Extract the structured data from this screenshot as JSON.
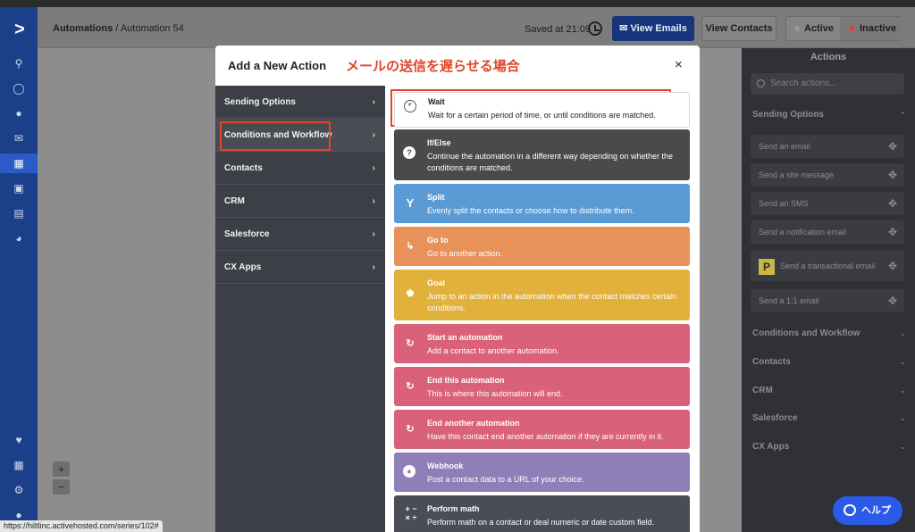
{
  "header": {
    "breadcrumb_root": "Automations",
    "breadcrumb_sep": "/",
    "breadcrumb_current": "Automation 54",
    "saved_text": "Saved at 21:09",
    "view_emails": "View Emails",
    "view_contacts": "View Contacts",
    "status_active": "Active",
    "status_inactive": "Inactive"
  },
  "modal": {
    "title": "Add a New Action",
    "annotation": "メールの送信を遅らせる場合",
    "close": "×",
    "categories": [
      {
        "label": "Sending Options"
      },
      {
        "label": "Conditions and Workflow"
      },
      {
        "label": "Contacts"
      },
      {
        "label": "CRM"
      },
      {
        "label": "Salesforce"
      },
      {
        "label": "CX Apps"
      }
    ],
    "actions": [
      {
        "title": "Wait",
        "desc": "Wait for a certain period of time, or until conditions are matched.",
        "icon": "clock-icon",
        "color": "#ffffff"
      },
      {
        "title": "If/Else",
        "desc": "Continue the automation in a different way depending on whether the conditions are matched.",
        "icon": "question-icon",
        "color": "#4a4a4a"
      },
      {
        "title": "Split",
        "desc": "Evenly split the contacts or choose how to distribute them.",
        "icon": "split-icon",
        "color": "#5b9bd5"
      },
      {
        "title": "Go to",
        "desc": "Go to another action.",
        "icon": "goto-icon",
        "color": "#e8925a"
      },
      {
        "title": "Goal",
        "desc": "Jump to an action in the automation when the contact matches certain conditions.",
        "icon": "trophy-icon",
        "color": "#e2b13c"
      },
      {
        "title": "Start an automation",
        "desc": "Add a contact to another automation.",
        "icon": "refresh-icon",
        "color": "#d9627a"
      },
      {
        "title": "End this automation",
        "desc": "This is where this automation will end.",
        "icon": "refresh-icon",
        "color": "#d9627a"
      },
      {
        "title": "End another automation",
        "desc": "Have this contact end another automation if they are currently in it.",
        "icon": "refresh-icon",
        "color": "#d9627a"
      },
      {
        "title": "Webhook",
        "desc": "Post a contact data to a URL of your choice.",
        "icon": "webhook-icon",
        "color": "#8f7fb8"
      },
      {
        "title": "Perform math",
        "desc": "Perform math on a contact or deal numeric or date custom field.",
        "icon": "math-icon",
        "color": "#4a4d55"
      }
    ]
  },
  "actions_panel": {
    "title": "Actions",
    "search_placeholder": "Search actions...",
    "sections": {
      "sending": "Sending Options",
      "conditions": "Conditions and Workflow",
      "contacts": "Contacts",
      "crm": "CRM",
      "salesforce": "Salesforce",
      "cx": "CX Apps"
    },
    "items": [
      "Send an email",
      "Send a site message",
      "Send an SMS",
      "Send a notification email",
      "Send a transactional email",
      "Send a 1:1 email"
    ]
  },
  "status_url": "https://hiltlinc.activehosted.com/series/102#",
  "help_label": "ヘルプ",
  "colors": {
    "rail": "#1c3f8a",
    "annotation": "#e0452a",
    "active_dot": "#3cc46a",
    "inactive_dot": "#e0452a"
  }
}
